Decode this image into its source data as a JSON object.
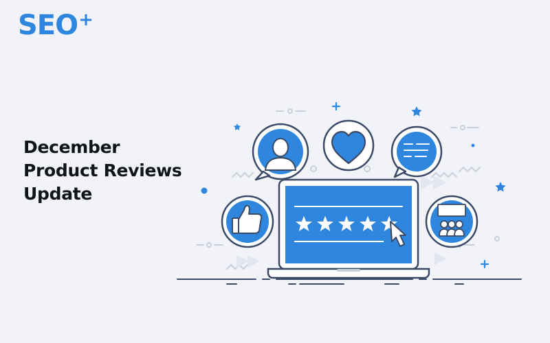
{
  "logo": {
    "text": "SEO",
    "superscript": "+"
  },
  "headline": {
    "line1": "December",
    "line2": "Product Reviews",
    "line3": "Update"
  },
  "rating": {
    "stars_filled": 5,
    "stars_total": 5
  },
  "colors": {
    "accent": "#2e86de",
    "accent_dark": "#1f6fc2",
    "outline": "#3a4a66",
    "background": "#f1f3f8",
    "headline": "#10131a"
  },
  "icons": [
    "user-icon",
    "heart-icon",
    "chat-bubble-icon",
    "thumbs-up-icon",
    "group-presentation-icon",
    "cursor-icon",
    "star-icon",
    "laptop-icon"
  ]
}
